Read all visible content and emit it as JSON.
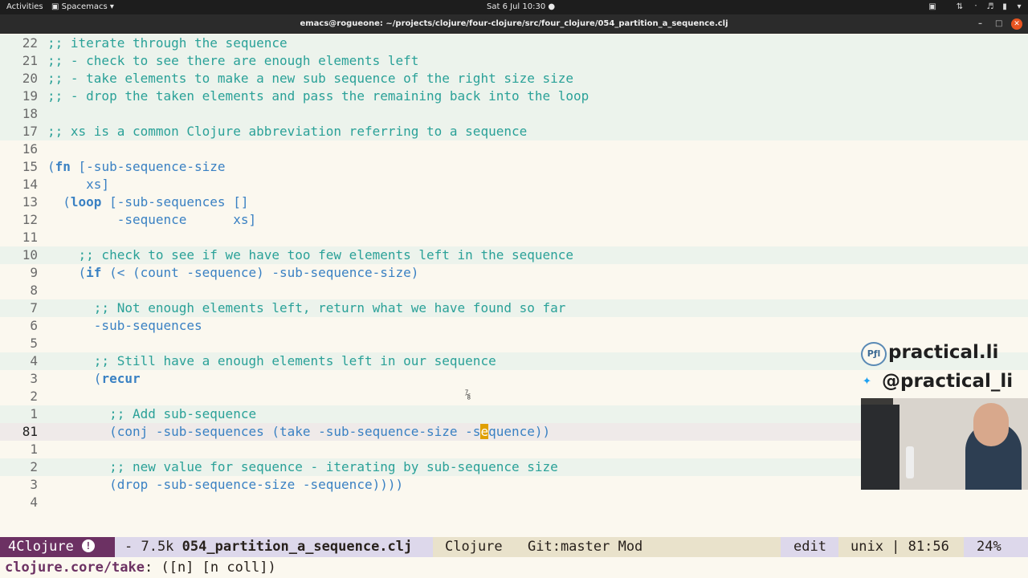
{
  "topbar": {
    "activities": "Activities",
    "app": "Spacemacs",
    "clock": "Sat 6 Jul  10:30"
  },
  "window": {
    "title": "emacs@rogueone: ~/projects/clojure/four-clojure/src/four_clojure/054_partition_a_sequence.clj"
  },
  "editor": {
    "lines": [
      {
        "num": "22",
        "indent": 0,
        "text": ";; iterate through the sequence",
        "comment": true
      },
      {
        "num": "21",
        "indent": 0,
        "text": ";; - check to see there are enough elements left",
        "comment": true
      },
      {
        "num": "20",
        "indent": 0,
        "text": ";; - take elements to make a new sub sequence of the right size size",
        "comment": true
      },
      {
        "num": "19",
        "indent": 0,
        "text": ";; - drop the taken elements and pass the remaining back into the loop",
        "comment": true
      },
      {
        "num": "18",
        "indent": 0,
        "text": "",
        "comment": true
      },
      {
        "num": "17",
        "indent": 0,
        "text": ";; xs is a common Clojure abbreviation referring to a sequence",
        "comment": true
      },
      {
        "num": "16",
        "indent": 0,
        "text": "",
        "comment": false
      },
      {
        "num": "15",
        "indent": 0,
        "text": "(fn [-sub-sequence-size",
        "comment": false
      },
      {
        "num": "14",
        "indent": 0,
        "text": "     xs]",
        "comment": false
      },
      {
        "num": "13",
        "indent": 0,
        "text": "  (loop [-sub-sequences []",
        "comment": false
      },
      {
        "num": "12",
        "indent": 0,
        "text": "         -sequence      xs]",
        "comment": false
      },
      {
        "num": "11",
        "indent": 0,
        "text": "",
        "comment": false
      },
      {
        "num": "10",
        "indent": 0,
        "text": "    ;; check to see if we have too few elements left in the sequence",
        "comment": true
      },
      {
        "num": "9",
        "indent": 0,
        "text": "    (if (< (count -sequence) -sub-sequence-size)",
        "comment": false
      },
      {
        "num": "8",
        "indent": 0,
        "text": "",
        "comment": false
      },
      {
        "num": "7",
        "indent": 0,
        "text": "      ;; Not enough elements left, return what we have found so far",
        "comment": true
      },
      {
        "num": "6",
        "indent": 0,
        "text": "      -sub-sequences",
        "comment": false
      },
      {
        "num": "5",
        "indent": 0,
        "text": "",
        "comment": false
      },
      {
        "num": "4",
        "indent": 0,
        "text": "      ;; Still have a enough elements left in our sequence",
        "comment": true
      },
      {
        "num": "3",
        "indent": 0,
        "text": "      (recur",
        "comment": false
      },
      {
        "num": "2",
        "indent": 0,
        "text": "",
        "comment": false
      },
      {
        "num": "1",
        "indent": 0,
        "text": "        ;; Add sub-sequence",
        "comment": true
      },
      {
        "num": "81",
        "indent": 0,
        "text": "        (conj -sub-sequences (take -sub-sequence-size -sequence))",
        "comment": false,
        "current": true
      },
      {
        "num": "1",
        "indent": 0,
        "text": "",
        "comment": false
      },
      {
        "num": "2",
        "indent": 0,
        "text": "        ;; new value for sequence - iterating by sub-sequence size",
        "comment": true
      },
      {
        "num": "3",
        "indent": 0,
        "text": "        (drop -sub-sequence-size -sequence))))",
        "comment": false
      },
      {
        "num": "4",
        "indent": 0,
        "text": "",
        "comment": false
      }
    ]
  },
  "overlay": {
    "site": "practical.li",
    "handle": "@practical_li",
    "logo_text": "Pƒl"
  },
  "modeline": {
    "state": "4Clojure",
    "size": "- 7.5k",
    "filename": "054_partition_a_sequence.clj",
    "major_mode": "Clojure",
    "vcs": "Git:master Mod",
    "edit_state": "edit",
    "encoding": "unix | 81:56",
    "percent": "24%"
  },
  "echo": {
    "fn": "clojure.core/take",
    "args": ": ([n] [n coll])"
  },
  "colors": {
    "background": "#fbf8ef",
    "comment": "#2aa198",
    "code": "#3a81c3",
    "state_bg": "#6c3163"
  }
}
